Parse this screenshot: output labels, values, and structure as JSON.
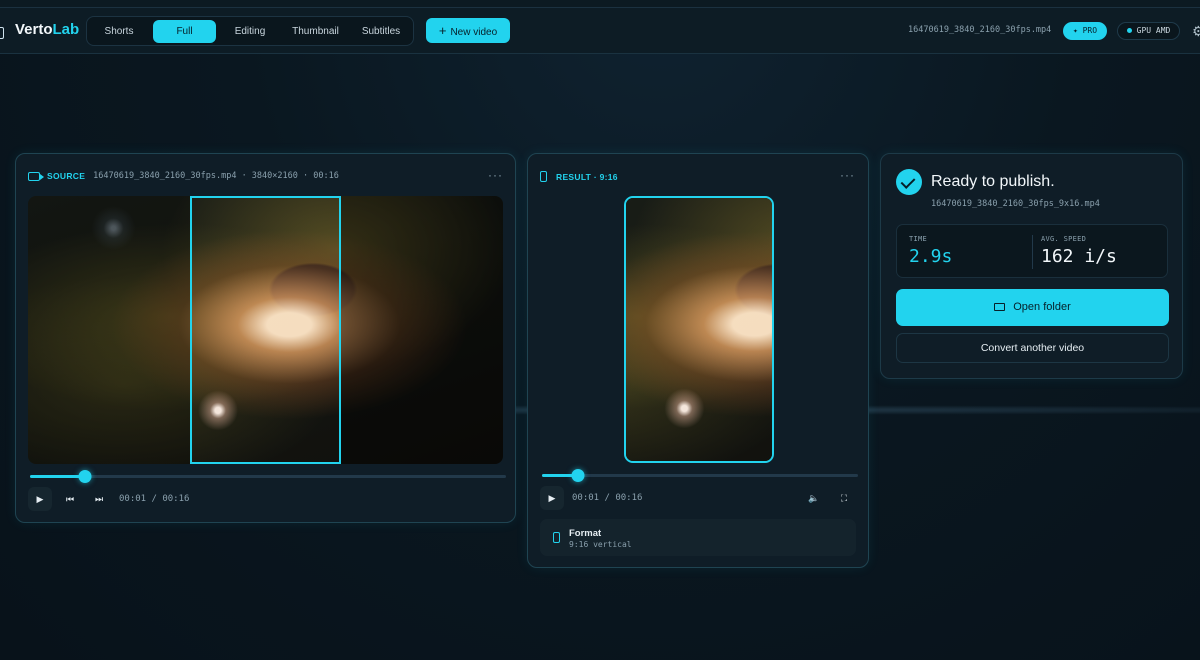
{
  "app": {
    "brand_main": "Verto",
    "brand_accent": "Lab"
  },
  "nav": {
    "items": [
      {
        "label": "Shorts",
        "active": false
      },
      {
        "label": "Full",
        "active": true
      },
      {
        "label": "Editing",
        "active": false
      },
      {
        "label": "Thumbnail",
        "active": false
      },
      {
        "label": "Subtitles",
        "active": false
      }
    ],
    "new_video_label": "New video"
  },
  "header": {
    "file_name": "16470619_3840_2160_30fps.mp4",
    "pro_label": "✦ PRO",
    "gpu_label": "GPU AMD",
    "settings_icon": "gear-icon"
  },
  "source": {
    "label": "SOURCE",
    "meta": "16470619_3840_2160_30fps.mp4 · 3840×2160 · 00:16",
    "time": "00:01 / 00:16",
    "progress": 0.115
  },
  "result": {
    "label": "RESULT · 9:16",
    "time": "00:01 / 00:16",
    "progress": 0.115,
    "format_title": "Format",
    "format_sub": "9:16 vertical"
  },
  "status": {
    "title": "Ready to publish.",
    "file": "16470619_3840_2160_30fps_9x16.mp4",
    "time_label": "TIME",
    "time_value": "2.9s",
    "speed_label": "AVG. SPEED",
    "speed_value": "162 i/s",
    "open_folder_label": "Open folder",
    "convert_another_label": "Convert another video"
  },
  "colors": {
    "accent": "#22d3ee",
    "background": "#08121a"
  }
}
